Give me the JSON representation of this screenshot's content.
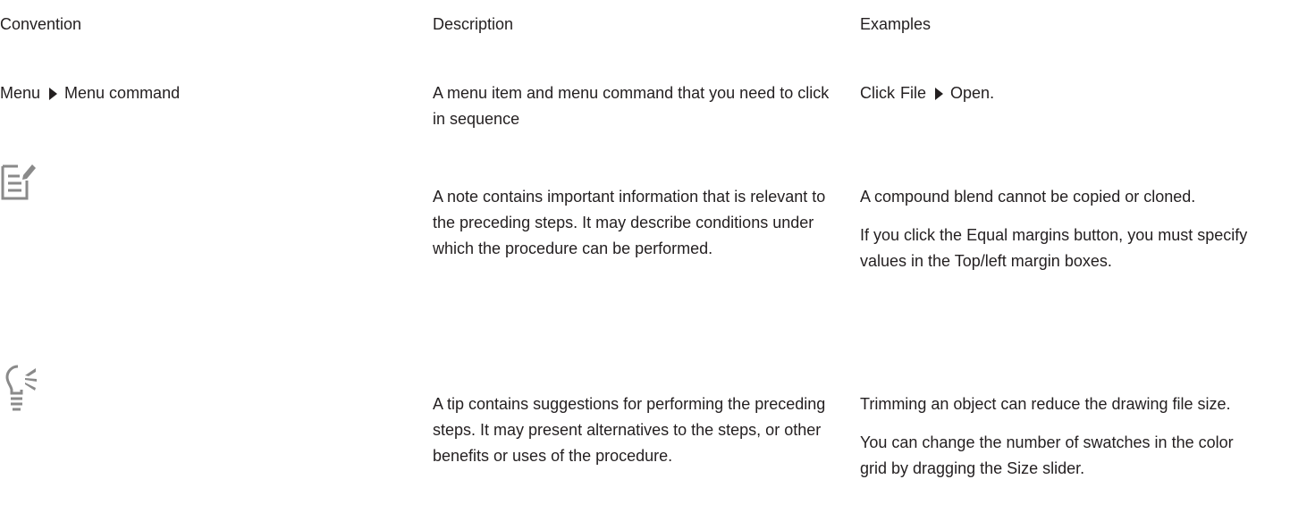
{
  "headers": {
    "convention": "Convention",
    "description": "Description",
    "examples": "Examples"
  },
  "rows": {
    "menu": {
      "convention_menu": "Menu",
      "convention_command": "Menu command",
      "description": "A menu item and menu command that you need to click in sequence",
      "example_prefix": "Click",
      "example_menu": "File",
      "example_command": "Open",
      "example_suffix": "."
    },
    "note": {
      "icon": "note-icon",
      "description": "A note contains important information that is relevant to the preceding steps. It may describe conditions under which the procedure can be performed.",
      "example1": "A compound blend cannot be copied or cloned.",
      "example2_pre": "If you click the",
      "example2_term1": "Equal margins",
      "example2_mid": "button, you must specify values in the",
      "example2_term2": "Top/left margin",
      "example2_post": "boxes."
    },
    "tip": {
      "icon": "tip-lightbulb-icon",
      "description": "A tip contains suggestions for performing the preceding steps. It may present alternatives to the steps, or other benefits or uses of the procedure.",
      "example1": "Trimming an object can reduce the drawing file size.",
      "example2_pre": "You can change the number of swatches in the color grid by dragging the",
      "example2_term": "Size",
      "example2_post": "slider."
    }
  },
  "colors": {
    "text": "#231f20",
    "icon": "#8a8a8a"
  }
}
